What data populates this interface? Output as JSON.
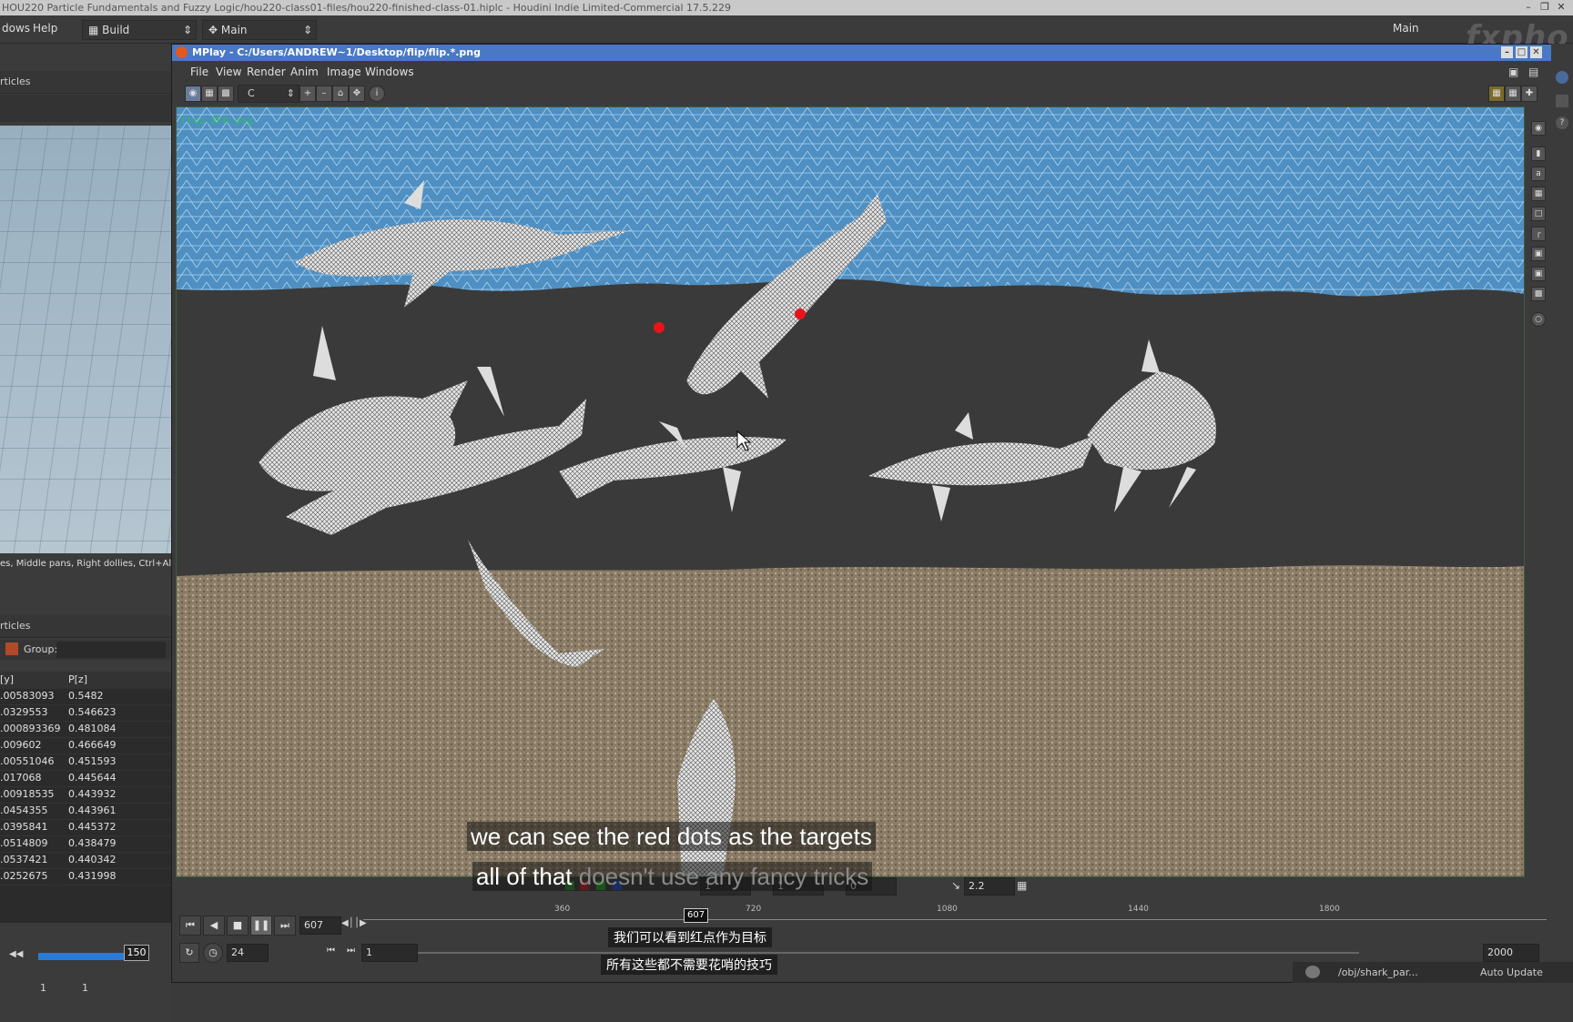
{
  "houdini": {
    "title": "HOU220 Particle Fundamentals and Fuzzy Logic/hou220-class01-files/hou220-finished-class-01.hiplc - Houdini Indie Limited-Commercial 17.5.229",
    "menus": [
      "dows",
      "Help"
    ],
    "desktop_label": "Build",
    "main_label": "Main",
    "main_label_right": "Main",
    "watermark": "fxpho"
  },
  "left_panel": {
    "panel1_title": "rticles",
    "status_text": "es, Middle pans, Right dollies, Ctrl+Alt+",
    "panel2_title": "rticles",
    "group_label": "Group:",
    "columns": [
      "[y]",
      "P[z]"
    ],
    "rows": [
      [
        ".00583093",
        "0.5482"
      ],
      [
        ".0329553",
        "0.546623"
      ],
      [
        ".000893369",
        "0.481084"
      ],
      [
        ".009602",
        "0.466649"
      ],
      [
        ".00551046",
        "0.451593"
      ],
      [
        ".017068",
        "0.445644"
      ],
      [
        ".00918535",
        "0.443932"
      ],
      [
        ".0454355",
        "0.443961"
      ],
      [
        ".0395841",
        "0.445372"
      ],
      [
        ".0514809",
        "0.438479"
      ],
      [
        ".0537421",
        "0.440342"
      ],
      [
        ".0252675",
        "0.431998"
      ]
    ],
    "slider_value": "150",
    "frame_start": "1",
    "frame_end": "1"
  },
  "mplay": {
    "title": "MPlay - C:/Users/ANDREW~1/Desktop/flip/flip.*.png",
    "menus": [
      "File",
      "View",
      "Render",
      "Anim",
      "Image",
      "Windows"
    ],
    "channel": "C",
    "viewer_overlay": "flip.$F4.png",
    "playbar": {
      "current_frame": "607",
      "fps": "24",
      "start_frame": "1",
      "end_frame": "2000",
      "frame_marker": "607",
      "gamma": "2.2",
      "field_zero": "0",
      "field_one": "1",
      "field_one_b": "1",
      "ticks": [
        "360",
        "720",
        "1080",
        "1440",
        "1800"
      ]
    }
  },
  "subtitles": {
    "en_line1": "we can see the red dots as the targets",
    "en_line2_a": "all of that ",
    "en_line2_b": "doesn't use any fancy tricks",
    "zh_line1": "我们可以看到红点作为目标",
    "zh_line2": "所有这些都不需要花哨的技巧"
  },
  "status_bar": {
    "path": "/obj/shark_par...",
    "mode": "Auto Update"
  },
  "colors": {
    "mplay_title_bg": "#4a78c4",
    "target_dot": "#e8141c",
    "water_net": "#5a9fd0",
    "sand": "#8a7a62"
  }
}
